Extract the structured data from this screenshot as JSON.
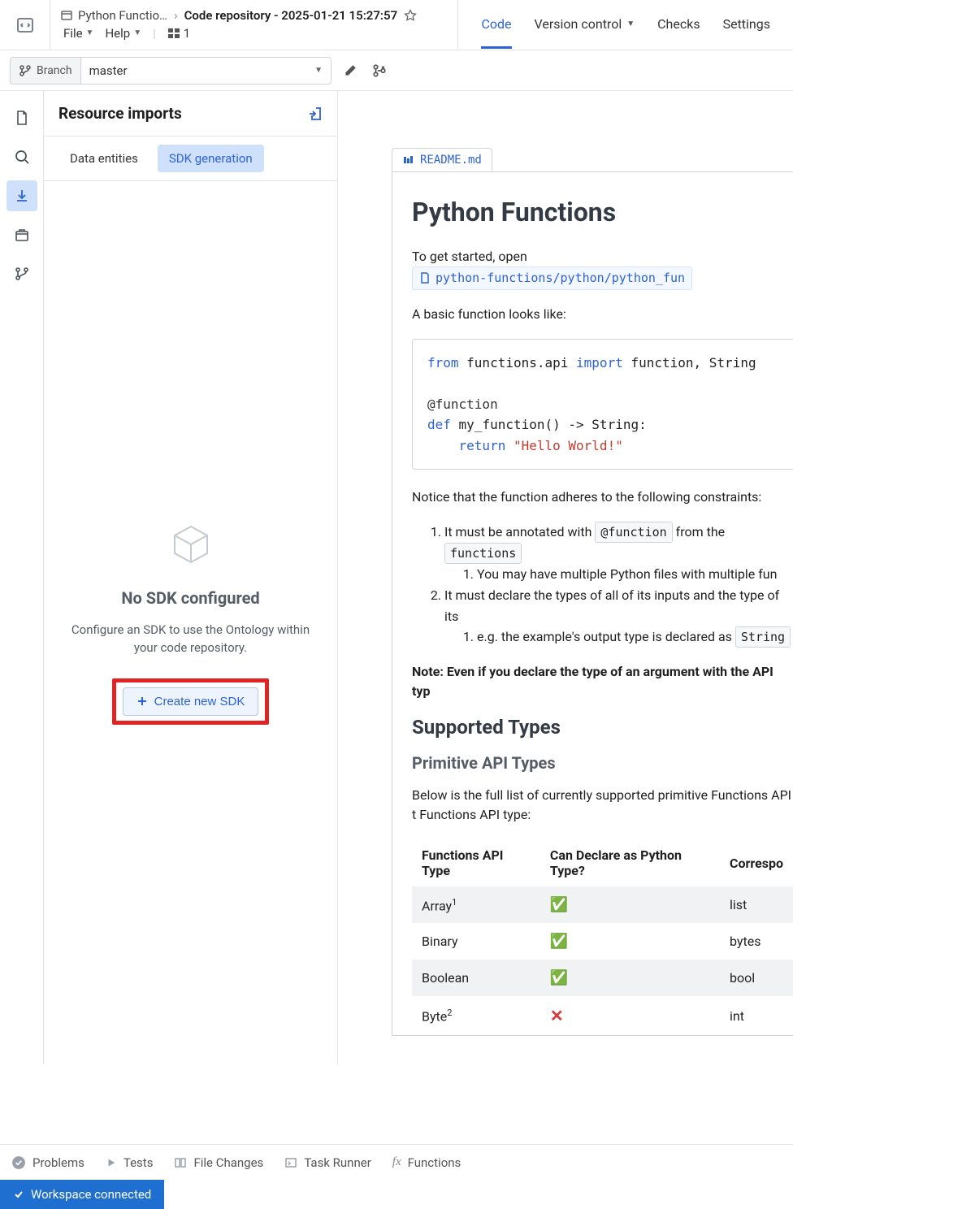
{
  "breadcrumb": {
    "crumb1": "Python Functio…",
    "crumb2": "Code repository - 2025-01-21 15:27:57"
  },
  "menubar": {
    "file": "File",
    "help": "Help",
    "counter": "1"
  },
  "topTabs": {
    "code": "Code",
    "vc": "Version control",
    "checks": "Checks",
    "settings": "Settings"
  },
  "branch": {
    "label": "Branch",
    "name": "master"
  },
  "resource": {
    "title": "Resource imports",
    "tabs": {
      "data": "Data entities",
      "sdk": "SDK generation"
    },
    "empty": {
      "heading": "No SDK configured",
      "desc": "Configure an SDK to use the Ontology within your code repository.",
      "button": "Create new SDK"
    }
  },
  "readme": {
    "filename": "README.md",
    "h1": "Python Functions",
    "intro1": "To get started, open",
    "filelink": "python-functions/python/python_fun",
    "intro2": "A basic function looks like:",
    "notice": "Notice that the function adheres to the following constraints:",
    "li1a": "It must be annotated with ",
    "li1b": " from the ",
    "chip1": "@function",
    "chip2": "functions",
    "li1_1": "You may have multiple Python files with multiple fun",
    "li2": "It must declare the types of all of its inputs and the type of its",
    "li2_1a": "e.g. the example's output type is declared as ",
    "chip3": "String",
    "note": "Note: Even if you declare the type of an argument with the API typ",
    "h2": "Supported Types",
    "h3": "Primitive API Types",
    "tdesc": "Below is the full list of currently supported primitive Functions API t Functions API type:",
    "table": {
      "headers": [
        "Functions API Type",
        "Can Declare as Python Type?",
        "Correspo"
      ],
      "rows": [
        {
          "name": "Array",
          "sup": "1",
          "ok": true,
          "py": "list"
        },
        {
          "name": "Binary",
          "sup": "",
          "ok": true,
          "py": "bytes"
        },
        {
          "name": "Boolean",
          "sup": "",
          "ok": true,
          "py": "bool"
        },
        {
          "name": "Byte",
          "sup": "2",
          "ok": false,
          "py": "int"
        }
      ]
    }
  },
  "code": {
    "l1a": "from",
    "l1b": " functions.api ",
    "l1c": "import",
    "l1d": " function, String",
    "l2": "@function",
    "l3a": "def",
    "l3b": " my_function() -> String:",
    "l4a": "    ",
    "l4b": "return",
    "l4c": " ",
    "l4d": "\"Hello World!\""
  },
  "bottom": {
    "problems": "Problems",
    "tests": "Tests",
    "filechanges": "File Changes",
    "taskrunner": "Task Runner",
    "functions": "Functions"
  },
  "status": {
    "connected": "Workspace connected"
  }
}
